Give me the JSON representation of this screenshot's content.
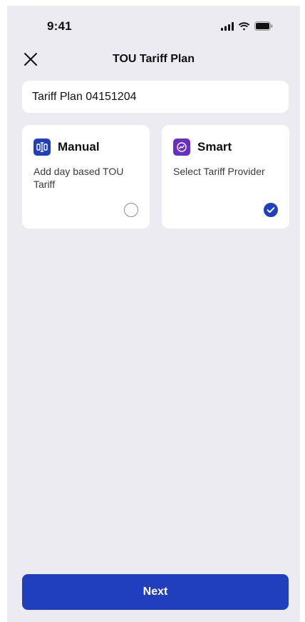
{
  "status_bar": {
    "time": "9:41",
    "icons": [
      "cellular-signal-icon",
      "wifi-icon",
      "battery-icon"
    ]
  },
  "header": {
    "title": "TOU Tariff Plan",
    "close_icon": "close-icon"
  },
  "plan_name": {
    "value": "Tariff Plan 04151204"
  },
  "options": [
    {
      "title": "Manual",
      "description": "Add day based TOU Tariff",
      "icon": "manual-tariff-icon",
      "selected": false,
      "icon_color": "#1F3FBF"
    },
    {
      "title": "Smart",
      "description": "Select Tariff Provider",
      "icon": "smart-tariff-icon",
      "selected": true,
      "icon_color": "#6A2FC2"
    }
  ],
  "footer": {
    "next_label": "Next"
  },
  "colors": {
    "background": "#EBEBF1",
    "card": "#FFFFFF",
    "accent": "#1F3FBF",
    "smart_accent": "#6A2FC2",
    "radio_border": "#8E8E93"
  }
}
